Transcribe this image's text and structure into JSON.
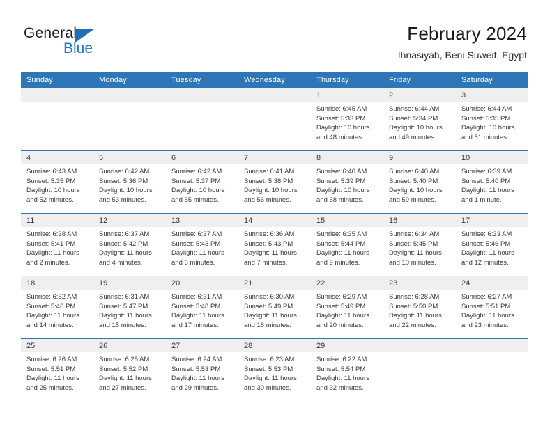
{
  "brand": {
    "name_part1": "General",
    "name_part2": "Blue",
    "triangle_color": "#1d6fb8",
    "blue_color": "#1b7cc4"
  },
  "header": {
    "title": "February 2024",
    "subtitle": "Ihnasiyah, Beni Suweif, Egypt",
    "header_bg": "#2d76b8",
    "row_border": "#2d76b8",
    "daynum_bg": "#efefef"
  },
  "weekdays": [
    "Sunday",
    "Monday",
    "Tuesday",
    "Wednesday",
    "Thursday",
    "Friday",
    "Saturday"
  ],
  "labels": {
    "sunrise_prefix": "Sunrise: ",
    "sunset_prefix": "Sunset: ",
    "daylight_prefix": "Daylight: "
  },
  "weeks": [
    [
      {
        "day": "",
        "empty": true
      },
      {
        "day": "",
        "empty": true
      },
      {
        "day": "",
        "empty": true
      },
      {
        "day": "",
        "empty": true
      },
      {
        "day": "1",
        "sunrise": "Sunrise: 6:45 AM",
        "sunset": "Sunset: 5:33 PM",
        "daylight1": "Daylight: 10 hours",
        "daylight2": "and 48 minutes."
      },
      {
        "day": "2",
        "sunrise": "Sunrise: 6:44 AM",
        "sunset": "Sunset: 5:34 PM",
        "daylight1": "Daylight: 10 hours",
        "daylight2": "and 49 minutes."
      },
      {
        "day": "3",
        "sunrise": "Sunrise: 6:44 AM",
        "sunset": "Sunset: 5:35 PM",
        "daylight1": "Daylight: 10 hours",
        "daylight2": "and 51 minutes."
      }
    ],
    [
      {
        "day": "4",
        "sunrise": "Sunrise: 6:43 AM",
        "sunset": "Sunset: 5:35 PM",
        "daylight1": "Daylight: 10 hours",
        "daylight2": "and 52 minutes."
      },
      {
        "day": "5",
        "sunrise": "Sunrise: 6:42 AM",
        "sunset": "Sunset: 5:36 PM",
        "daylight1": "Daylight: 10 hours",
        "daylight2": "and 53 minutes."
      },
      {
        "day": "6",
        "sunrise": "Sunrise: 6:42 AM",
        "sunset": "Sunset: 5:37 PM",
        "daylight1": "Daylight: 10 hours",
        "daylight2": "and 55 minutes."
      },
      {
        "day": "7",
        "sunrise": "Sunrise: 6:41 AM",
        "sunset": "Sunset: 5:38 PM",
        "daylight1": "Daylight: 10 hours",
        "daylight2": "and 56 minutes."
      },
      {
        "day": "8",
        "sunrise": "Sunrise: 6:40 AM",
        "sunset": "Sunset: 5:39 PM",
        "daylight1": "Daylight: 10 hours",
        "daylight2": "and 58 minutes."
      },
      {
        "day": "9",
        "sunrise": "Sunrise: 6:40 AM",
        "sunset": "Sunset: 5:40 PM",
        "daylight1": "Daylight: 10 hours",
        "daylight2": "and 59 minutes."
      },
      {
        "day": "10",
        "sunrise": "Sunrise: 6:39 AM",
        "sunset": "Sunset: 5:40 PM",
        "daylight1": "Daylight: 11 hours",
        "daylight2": "and 1 minute."
      }
    ],
    [
      {
        "day": "11",
        "sunrise": "Sunrise: 6:38 AM",
        "sunset": "Sunset: 5:41 PM",
        "daylight1": "Daylight: 11 hours",
        "daylight2": "and 2 minutes."
      },
      {
        "day": "12",
        "sunrise": "Sunrise: 6:37 AM",
        "sunset": "Sunset: 5:42 PM",
        "daylight1": "Daylight: 11 hours",
        "daylight2": "and 4 minutes."
      },
      {
        "day": "13",
        "sunrise": "Sunrise: 6:37 AM",
        "sunset": "Sunset: 5:43 PM",
        "daylight1": "Daylight: 11 hours",
        "daylight2": "and 6 minutes."
      },
      {
        "day": "14",
        "sunrise": "Sunrise: 6:36 AM",
        "sunset": "Sunset: 5:43 PM",
        "daylight1": "Daylight: 11 hours",
        "daylight2": "and 7 minutes."
      },
      {
        "day": "15",
        "sunrise": "Sunrise: 6:35 AM",
        "sunset": "Sunset: 5:44 PM",
        "daylight1": "Daylight: 11 hours",
        "daylight2": "and 9 minutes."
      },
      {
        "day": "16",
        "sunrise": "Sunrise: 6:34 AM",
        "sunset": "Sunset: 5:45 PM",
        "daylight1": "Daylight: 11 hours",
        "daylight2": "and 10 minutes."
      },
      {
        "day": "17",
        "sunrise": "Sunrise: 6:33 AM",
        "sunset": "Sunset: 5:46 PM",
        "daylight1": "Daylight: 11 hours",
        "daylight2": "and 12 minutes."
      }
    ],
    [
      {
        "day": "18",
        "sunrise": "Sunrise: 6:32 AM",
        "sunset": "Sunset: 5:46 PM",
        "daylight1": "Daylight: 11 hours",
        "daylight2": "and 14 minutes."
      },
      {
        "day": "19",
        "sunrise": "Sunrise: 6:31 AM",
        "sunset": "Sunset: 5:47 PM",
        "daylight1": "Daylight: 11 hours",
        "daylight2": "and 15 minutes."
      },
      {
        "day": "20",
        "sunrise": "Sunrise: 6:31 AM",
        "sunset": "Sunset: 5:48 PM",
        "daylight1": "Daylight: 11 hours",
        "daylight2": "and 17 minutes."
      },
      {
        "day": "21",
        "sunrise": "Sunrise: 6:30 AM",
        "sunset": "Sunset: 5:49 PM",
        "daylight1": "Daylight: 11 hours",
        "daylight2": "and 18 minutes."
      },
      {
        "day": "22",
        "sunrise": "Sunrise: 6:29 AM",
        "sunset": "Sunset: 5:49 PM",
        "daylight1": "Daylight: 11 hours",
        "daylight2": "and 20 minutes."
      },
      {
        "day": "23",
        "sunrise": "Sunrise: 6:28 AM",
        "sunset": "Sunset: 5:50 PM",
        "daylight1": "Daylight: 11 hours",
        "daylight2": "and 22 minutes."
      },
      {
        "day": "24",
        "sunrise": "Sunrise: 6:27 AM",
        "sunset": "Sunset: 5:51 PM",
        "daylight1": "Daylight: 11 hours",
        "daylight2": "and 23 minutes."
      }
    ],
    [
      {
        "day": "25",
        "sunrise": "Sunrise: 6:26 AM",
        "sunset": "Sunset: 5:51 PM",
        "daylight1": "Daylight: 11 hours",
        "daylight2": "and 25 minutes."
      },
      {
        "day": "26",
        "sunrise": "Sunrise: 6:25 AM",
        "sunset": "Sunset: 5:52 PM",
        "daylight1": "Daylight: 11 hours",
        "daylight2": "and 27 minutes."
      },
      {
        "day": "27",
        "sunrise": "Sunrise: 6:24 AM",
        "sunset": "Sunset: 5:53 PM",
        "daylight1": "Daylight: 11 hours",
        "daylight2": "and 29 minutes."
      },
      {
        "day": "28",
        "sunrise": "Sunrise: 6:23 AM",
        "sunset": "Sunset: 5:53 PM",
        "daylight1": "Daylight: 11 hours",
        "daylight2": "and 30 minutes."
      },
      {
        "day": "29",
        "sunrise": "Sunrise: 6:22 AM",
        "sunset": "Sunset: 5:54 PM",
        "daylight1": "Daylight: 11 hours",
        "daylight2": "and 32 minutes."
      },
      {
        "day": "",
        "empty": true
      },
      {
        "day": "",
        "empty": true
      }
    ]
  ]
}
